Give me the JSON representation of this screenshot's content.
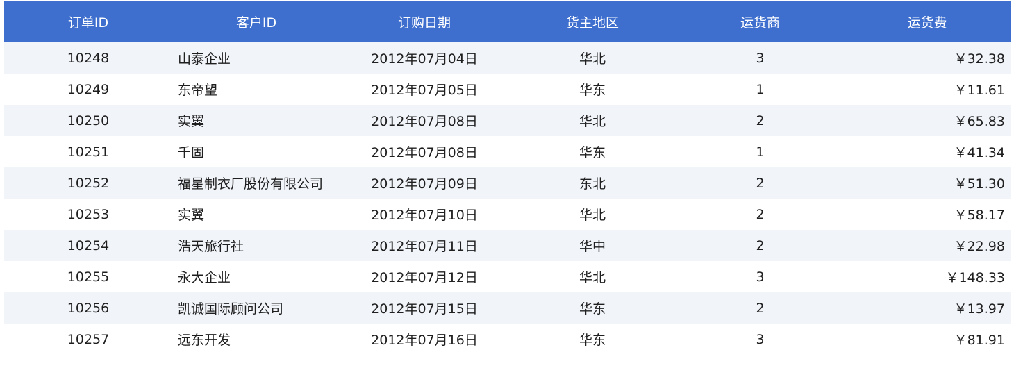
{
  "table": {
    "headers": [
      "订单ID",
      "客户ID",
      "订购日期",
      "货主地区",
      "运货商",
      "运货费"
    ],
    "rows": [
      [
        "10248",
        "山泰企业",
        "2012年07月04日",
        "华北",
        "3",
        "￥32.38"
      ],
      [
        "10249",
        "东帝望",
        "2012年07月05日",
        "华东",
        "1",
        "￥11.61"
      ],
      [
        "10250",
        "实翼",
        "2012年07月08日",
        "华北",
        "2",
        "￥65.83"
      ],
      [
        "10251",
        "千固",
        "2012年07月08日",
        "华东",
        "1",
        "￥41.34"
      ],
      [
        "10252",
        "福星制衣厂股份有限公司",
        "2012年07月09日",
        "东北",
        "2",
        "￥51.30"
      ],
      [
        "10253",
        "实翼",
        "2012年07月10日",
        "华北",
        "2",
        "￥58.17"
      ],
      [
        "10254",
        "浩天旅行社",
        "2012年07月11日",
        "华中",
        "2",
        "￥22.98"
      ],
      [
        "10255",
        "永大企业",
        "2012年07月12日",
        "华北",
        "3",
        "￥148.33"
      ],
      [
        "10256",
        "凯诚国际顾问公司",
        "2012年07月15日",
        "华东",
        "2",
        "￥13.97"
      ],
      [
        "10257",
        "远东开发",
        "2012年07月16日",
        "华东",
        "3",
        "￥81.91"
      ]
    ]
  },
  "colors": {
    "header_bg": "#3e6fce",
    "header_text": "#ffffff",
    "row_stripe": "#f1f4f9",
    "row_plain": "#ffffff"
  }
}
